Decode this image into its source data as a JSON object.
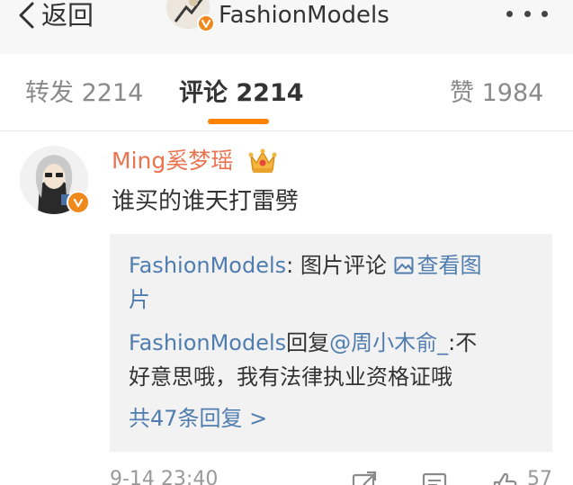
{
  "nav": {
    "back_label": "返回",
    "title": "FashionModels",
    "more_icon": "more-dots-icon"
  },
  "tabs": [
    {
      "label": "转发 2214",
      "active": false
    },
    {
      "label": "评论 2214",
      "active": true
    },
    {
      "label": "赞 1984",
      "active": false
    }
  ],
  "comment": {
    "username": "Ming奚梦瑶",
    "text": "谁买的谁天打雷劈",
    "reply_box": {
      "line1_author": "FashionModels",
      "line1_sep": ": 图片评论 ",
      "line1_link": "查看图",
      "line2_link": "片",
      "line3_author": "FashionModels",
      "line3_verb": "回复",
      "line3_mention": "@周小木俞_",
      "line3_text": ":不",
      "line4_text": "好意思哦，我有法律执业资格证哦",
      "more_replies": "共47条回复 >"
    },
    "time": "9-14 23:40",
    "like_count": "57"
  },
  "colors": {
    "accent": "#ff8200",
    "username": "#eb7350",
    "link": "#507daf",
    "verified": "#f0891c"
  }
}
